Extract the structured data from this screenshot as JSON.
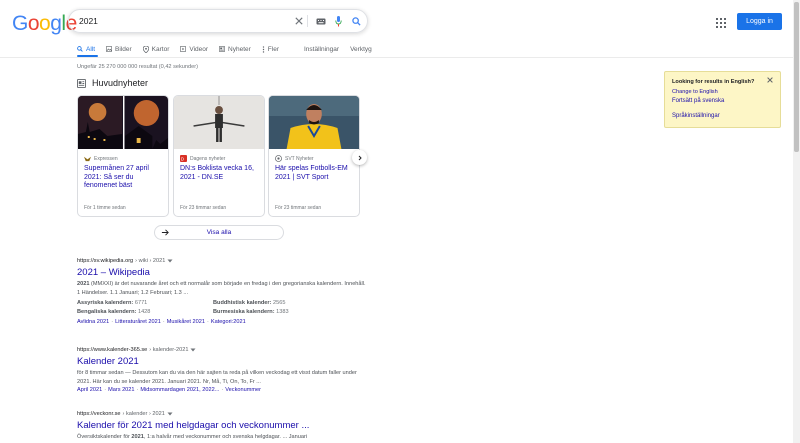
{
  "logo": {
    "letters": [
      "G",
      "o",
      "o",
      "g",
      "l",
      "e"
    ],
    "colors": [
      "#4285f4",
      "#ea4335",
      "#fbbc05",
      "#4285f4",
      "#34a853",
      "#ea4335"
    ]
  },
  "search": {
    "value": "2021"
  },
  "header": {
    "signin_label": "Logga in"
  },
  "tabs": [
    {
      "label": "Allt",
      "icon": "search-icon",
      "active": true
    },
    {
      "label": "Bilder",
      "icon": "image-icon"
    },
    {
      "label": "Kartor",
      "icon": "map-pin-icon"
    },
    {
      "label": "Videor",
      "icon": "video-icon"
    },
    {
      "label": "Nyheter",
      "icon": "news-icon"
    },
    {
      "label": "Fler",
      "icon": "more-vertical-icon"
    },
    {
      "label": "Inställningar"
    },
    {
      "label": "Verktyg"
    }
  ],
  "result_stats": "Ungefär 25 270 000 000 resultat (0,42 sekunder)",
  "news": {
    "heading": "Huvudnyheter",
    "cards": [
      {
        "source": "Expressen",
        "headline": "Supermånen 27 april 2021: Så ser du fenomenet bäst",
        "time": "För 1 timme sedan",
        "fav_color": "#8b6914"
      },
      {
        "source": "Dagens nyheter",
        "headline": "DN:s Boklista vecka 16, 2021 - DN.SE",
        "time": "För 23 timmar sedan",
        "fav_color": "#d93025"
      },
      {
        "source": "SVT Nyheter",
        "headline": "Här spelas Fotbolls-EM 2021 | SVT Sport",
        "time": "För 23 timmar sedan",
        "fav_color": "#5f6368"
      }
    ],
    "view_all": "Visa alla"
  },
  "results": [
    {
      "url": "https://sv.wikipedia.org",
      "crumb": "› wiki › 2021",
      "title": "2021 – Wikipedia",
      "snippet_bold": "2021",
      "snippet": " (MMXXI) är det nuvarande året och ett normalår som började en fredag i den gregorianska kalendern. Innehåll. 1 Händelser. 1.1 Januari; 1.2 Februari; 1.3 ...",
      "facts": [
        {
          "k": "Assyriska kalendern:",
          "v": "6771"
        },
        {
          "k": "Buddhistisk kalender:",
          "v": "2565"
        },
        {
          "k": "Bengaliska kalendern:",
          "v": "1428"
        },
        {
          "k": "Burmesiska kalendern:",
          "v": "1383"
        }
      ],
      "sitelinks": [
        "Avlidna 2021",
        "Litteraturåret 2021",
        "Musikåret 2021",
        "Kategori:2021"
      ]
    },
    {
      "url": "https://www.kalender-365.se",
      "crumb": "› kalender-2021",
      "title": "Kalender 2021",
      "snippet": "för 8 timmar sedan — Dessutom kan du via den här sajten ta reda på vilken veckodag ett visst datum faller under 2021. Här kan du se kalender 2021. Januari 2021. Nr, Må, Ti, On, To, Fr ...",
      "sitelinks": [
        "April 2021",
        "Mars 2021",
        "Midsommardagen 2021, 2022...",
        "Veckonummer"
      ]
    },
    {
      "url": "https://veckonr.se",
      "crumb": "› kalender › 2021",
      "title": "Kalender för 2021 med helgdagar och veckonummer ...",
      "snippet_pre": "Översiktskalender för ",
      "snippet_bold": "2021",
      "snippet": ", 1:a halvår med veckonummer och svenska helgdagar. ... Januari"
    }
  ],
  "language_box": {
    "question": "Looking for results in English?",
    "change": "Change to English",
    "keep": "Fortsätt på svenska",
    "settings": "Språkinställningar"
  }
}
